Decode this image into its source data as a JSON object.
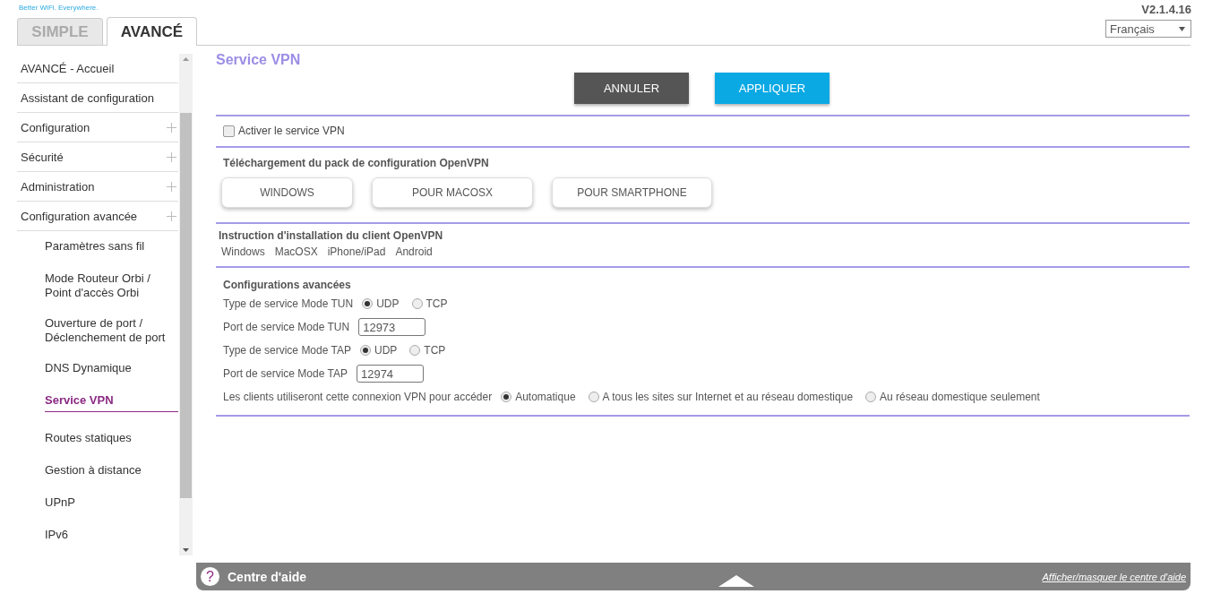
{
  "header": {
    "tagline": "Better WiFi. Everywhere.",
    "version": "V2.1.4.16",
    "language": {
      "value": "Français"
    }
  },
  "tabs": [
    {
      "label": "SIMPLE",
      "selected": false
    },
    {
      "label": "AVANCÉ",
      "selected": true
    }
  ],
  "sidebar": {
    "items": [
      {
        "label": "AVANCÉ - Accueil",
        "expandable": false
      },
      {
        "label": "Assistant de configuration",
        "expandable": false
      },
      {
        "label": "Configuration",
        "expandable": true
      },
      {
        "label": "Sécurité",
        "expandable": true
      },
      {
        "label": "Administration",
        "expandable": true
      },
      {
        "label": "Configuration avancée",
        "expandable": true,
        "children": [
          {
            "label": "Paramètres sans fil",
            "selected": false
          },
          {
            "label": "Mode Routeur Orbi / Point d'accès Orbi",
            "selected": false
          },
          {
            "label": "Ouverture de port / Déclenchement de port",
            "selected": false
          },
          {
            "label": "DNS Dynamique",
            "selected": false
          },
          {
            "label": "Service VPN",
            "selected": true
          },
          {
            "label": "Routes statiques",
            "selected": false
          },
          {
            "label": "Gestion à distance",
            "selected": false
          },
          {
            "label": "UPnP",
            "selected": false
          },
          {
            "label": "IPv6",
            "selected": false
          }
        ]
      }
    ]
  },
  "page": {
    "title": "Service VPN",
    "buttons": [
      {
        "label": "ANNULER",
        "kind": "secondary"
      },
      {
        "label": "APPLIQUER",
        "kind": "primary"
      }
    ],
    "enable": {
      "label": "Activer le service VPN",
      "checked": false
    },
    "download": {
      "heading": "Téléchargement du pack de configuration OpenVPN",
      "buttons": [
        "WINDOWS",
        "POUR MACOSX",
        "POUR SMARTPHONE"
      ]
    },
    "instructions": {
      "heading": "Instruction d'installation du client OpenVPN",
      "links": [
        "Windows",
        "MacOSX",
        "iPhone/iPad",
        "Android"
      ]
    },
    "advanced": {
      "heading": "Configurations avancées",
      "rows": [
        {
          "kind": "radio",
          "label": "Type de service Mode TUN",
          "options": [
            {
              "label": "UDP",
              "selected": true
            },
            {
              "label": "TCP",
              "selected": false
            }
          ]
        },
        {
          "kind": "input",
          "label": "Port de service Mode TUN",
          "value": "12973"
        },
        {
          "kind": "radio",
          "label": "Type de service Mode TAP",
          "options": [
            {
              "label": "UDP",
              "selected": true
            },
            {
              "label": "TCP",
              "selected": false
            }
          ]
        },
        {
          "kind": "input",
          "label": "Port de service Mode TAP",
          "value": "12974"
        },
        {
          "kind": "radio",
          "label": "Les clients utiliseront cette connexion VPN pour accéder",
          "options": [
            {
              "label": "Automatique",
              "selected": true
            },
            {
              "label": "A tous les sites sur Internet et au réseau domestique",
              "selected": false
            },
            {
              "label": "Au réseau domestique seulement",
              "selected": false
            }
          ]
        }
      ]
    }
  },
  "help_bar": {
    "icon": "?",
    "title": "Centre d'aide",
    "link": "Afficher/masquer le centre d'aide"
  }
}
